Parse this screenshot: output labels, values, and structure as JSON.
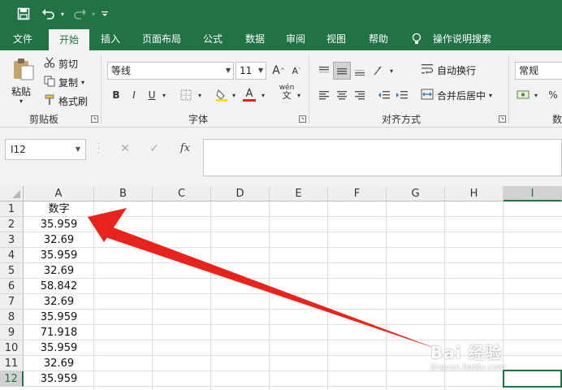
{
  "quick_access": {
    "save_icon": "save-icon",
    "undo_icon": "undo-icon",
    "redo_icon": "redo-icon",
    "customize_icon": "customize-icon"
  },
  "tabs": [
    {
      "label": "文件",
      "active": false
    },
    {
      "label": "开始",
      "active": true
    },
    {
      "label": "插入",
      "active": false
    },
    {
      "label": "页面布局",
      "active": false
    },
    {
      "label": "公式",
      "active": false
    },
    {
      "label": "数据",
      "active": false
    },
    {
      "label": "审阅",
      "active": false
    },
    {
      "label": "视图",
      "active": false
    },
    {
      "label": "帮助",
      "active": false
    }
  ],
  "tell_me": {
    "label": "操作说明搜索",
    "icon": "lightbulb-icon"
  },
  "ribbon": {
    "clipboard": {
      "paste": "粘贴",
      "cut": "剪切",
      "copy": "复制",
      "format_painter": "格式刷",
      "group_label": "剪贴板"
    },
    "font": {
      "font_name": "等线",
      "font_size": "11",
      "bold": "B",
      "italic": "I",
      "underline": "U",
      "grow": "A",
      "shrink": "A",
      "font_color_glyph": "A",
      "phonetic": "wén",
      "group_label": "字体"
    },
    "alignment": {
      "wrap_text": "自动换行",
      "merge_center": "合并后居中",
      "group_label": "对齐方式"
    },
    "number": {
      "format": "常规",
      "percent": "%",
      "group_label": "数"
    }
  },
  "formula_bar": {
    "name_box": "I12",
    "cancel": "✕",
    "enter": "✓",
    "fx": "fx",
    "value": ""
  },
  "columns": [
    "A",
    "B",
    "C",
    "D",
    "E",
    "F",
    "G",
    "H",
    "I"
  ],
  "selected_column": "I",
  "rows": [
    "1",
    "2",
    "3",
    "4",
    "5",
    "6",
    "7",
    "8",
    "9",
    "10",
    "11",
    "12"
  ],
  "selected_row": "12",
  "column_a": [
    "数字",
    "35.959",
    "32.69",
    "35.959",
    "32.69",
    "58.842",
    "32.69",
    "35.959",
    "71.918",
    "35.959",
    "32.69",
    "35.959"
  ],
  "accent_color": "#217346",
  "annotation_color": "#e8231c",
  "watermark": {
    "main": "Bai 经验",
    "sub": "jingyan.baidu.com"
  }
}
